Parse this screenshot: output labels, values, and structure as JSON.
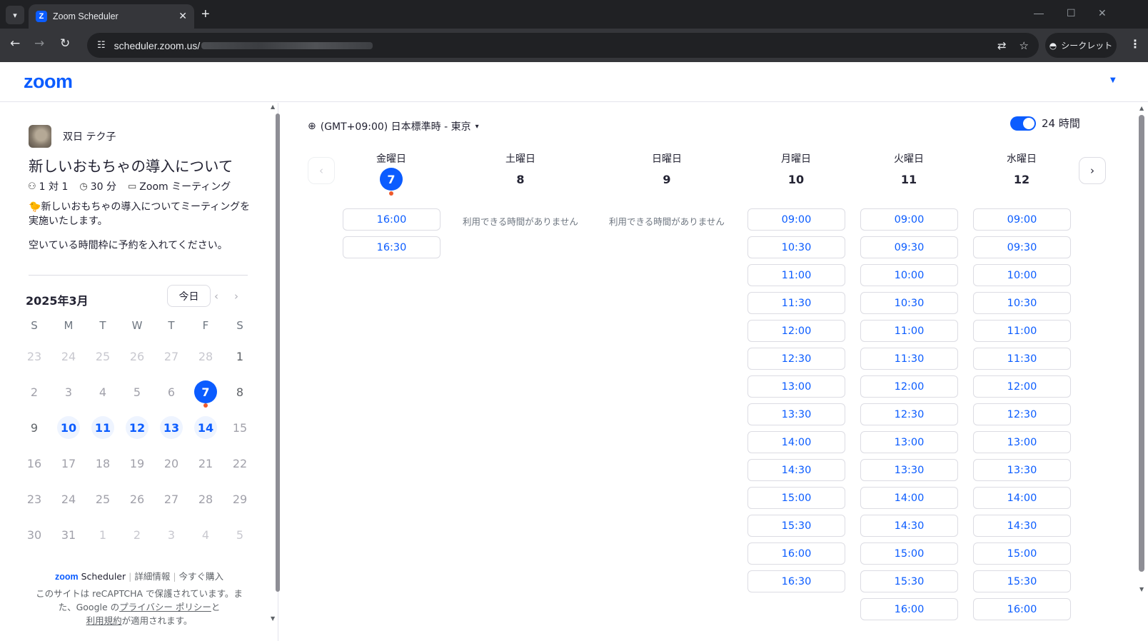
{
  "browser": {
    "tab_title": "Zoom Scheduler",
    "favicon_letter": "Z",
    "url": "scheduler.zoom.us/",
    "incognito_label": "シークレット"
  },
  "header": {
    "logo": "zoom"
  },
  "host": {
    "name": "双日 テク子"
  },
  "event": {
    "title": "新しいおもちゃの導入について",
    "format": "1 対 1",
    "duration": "30 分",
    "meeting_type": "Zoom ミーティング",
    "description": "新しいおもちゃの導入についてミーティングを実施いたします。",
    "note": "空いている時間枠に予約を入れてください。"
  },
  "mini_calendar": {
    "month_label": "2025年3月",
    "today_label": "今日",
    "weekdays": [
      "S",
      "M",
      "T",
      "W",
      "T",
      "F",
      "S"
    ],
    "weeks": [
      [
        "23",
        "24",
        "25",
        "26",
        "27",
        "28",
        "1"
      ],
      [
        "2",
        "3",
        "4",
        "5",
        "6",
        "7",
        "8"
      ],
      [
        "9",
        "10",
        "11",
        "12",
        "13",
        "14",
        "15"
      ],
      [
        "16",
        "17",
        "18",
        "19",
        "20",
        "21",
        "22"
      ],
      [
        "23",
        "24",
        "25",
        "26",
        "27",
        "28",
        "29"
      ],
      [
        "30",
        "31",
        "1",
        "2",
        "3",
        "4",
        "5"
      ]
    ]
  },
  "footer": {
    "brand": "zoom",
    "brand_suffix": "Scheduler",
    "details_link": "詳細情報",
    "buy_link": "今すぐ購入",
    "recaptcha_1": "このサイトは reCAPTCHA で保護されています。また、Google の",
    "privacy_link": "プライバシー ポリシー",
    "recaptcha_2": "と",
    "terms_link": "利用規約",
    "recaptcha_3": "が適用されます。"
  },
  "schedule": {
    "timezone": "(GMT+09:00) 日本標準時 - 東京",
    "toggle_label": "24 時間",
    "no_slots_text": "利用できる時間がありません",
    "days": [
      {
        "dow": "金曜日",
        "date": "7",
        "slots": [
          "16:00",
          "16:30"
        ]
      },
      {
        "dow": "土曜日",
        "date": "8",
        "slots": []
      },
      {
        "dow": "日曜日",
        "date": "9",
        "slots": []
      },
      {
        "dow": "月曜日",
        "date": "10",
        "slots": [
          "09:00",
          "10:30",
          "11:00",
          "11:30",
          "12:00",
          "12:30",
          "13:00",
          "13:30",
          "14:00",
          "14:30",
          "15:00",
          "15:30",
          "16:00",
          "16:30"
        ]
      },
      {
        "dow": "火曜日",
        "date": "11",
        "slots": [
          "09:00",
          "09:30",
          "10:00",
          "10:30",
          "11:00",
          "11:30",
          "12:00",
          "12:30",
          "13:00",
          "13:30",
          "14:00",
          "14:30",
          "15:00",
          "15:30",
          "16:00"
        ]
      },
      {
        "dow": "水曜日",
        "date": "12",
        "slots": [
          "09:00",
          "09:30",
          "10:00",
          "10:30",
          "11:00",
          "11:30",
          "12:00",
          "12:30",
          "13:00",
          "13:30",
          "14:00",
          "14:30",
          "15:00",
          "15:30",
          "16:00"
        ]
      }
    ]
  },
  "colors": {
    "brand": "#0b5cff",
    "selected_dot": "#ee5a2c"
  }
}
